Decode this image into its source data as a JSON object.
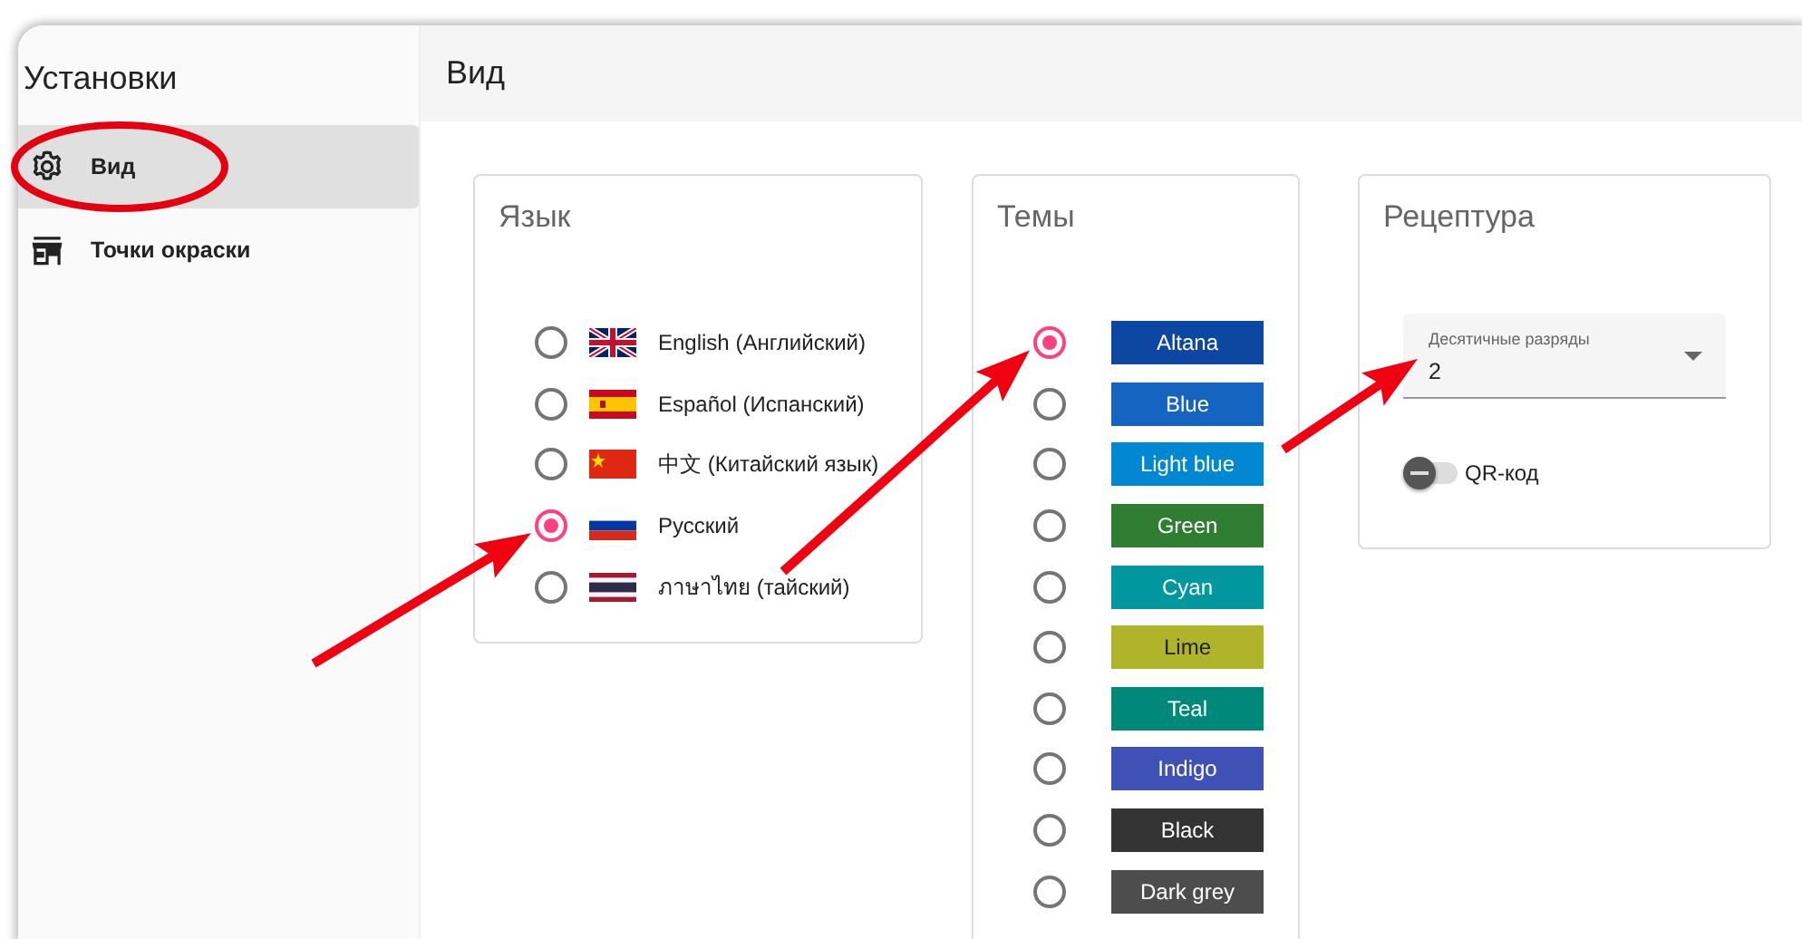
{
  "sidebar": {
    "title": "Установки",
    "items": [
      {
        "label": "Вид",
        "kind": "gear",
        "selected": true
      },
      {
        "label": "Точки окраски",
        "kind": "store",
        "selected": false
      }
    ]
  },
  "header": {
    "title": "Вид"
  },
  "language_card": {
    "title": "Язык",
    "options": [
      {
        "label": "English (Английский)",
        "kind": "gb",
        "selected": false
      },
      {
        "label": "Español (Испанский)",
        "kind": "es",
        "selected": false
      },
      {
        "label": "中文 (Китайский язык)",
        "kind": "cn",
        "selected": false
      },
      {
        "label": "Русский",
        "kind": "ru",
        "selected": true
      },
      {
        "label": "ภาษาไทย (тайский)",
        "kind": "th",
        "selected": false
      }
    ]
  },
  "theme_card": {
    "title": "Темы",
    "options": [
      {
        "label": "Altana",
        "color": "#0d47a1",
        "selected": true
      },
      {
        "label": "Blue",
        "color": "#1565c0",
        "selected": false
      },
      {
        "label": "Light blue",
        "color": "#0288d1",
        "selected": false
      },
      {
        "label": "Green",
        "color": "#2e7d32",
        "selected": false
      },
      {
        "label": "Cyan",
        "color": "#00979e",
        "selected": false
      },
      {
        "label": "Lime",
        "color": "#afb42b",
        "selected": false
      },
      {
        "label": "Teal",
        "color": "#00897b",
        "selected": false
      },
      {
        "label": "Indigo",
        "color": "#3f51b5",
        "selected": false
      },
      {
        "label": "Black",
        "color": "#333333",
        "selected": false
      },
      {
        "label": "Dark grey",
        "color": "#4d4d4d",
        "selected": false
      }
    ]
  },
  "recipe_card": {
    "title": "Рецептура",
    "decimal_field": {
      "label": "Десятичные разряды",
      "value": "2"
    },
    "qr_switch": {
      "label": "QR-код",
      "on": false
    }
  },
  "annotations": [
    {
      "kind": "ellipse"
    },
    {
      "kind": "arrow"
    },
    {
      "kind": "arrow"
    },
    {
      "kind": "arrow"
    }
  ]
}
